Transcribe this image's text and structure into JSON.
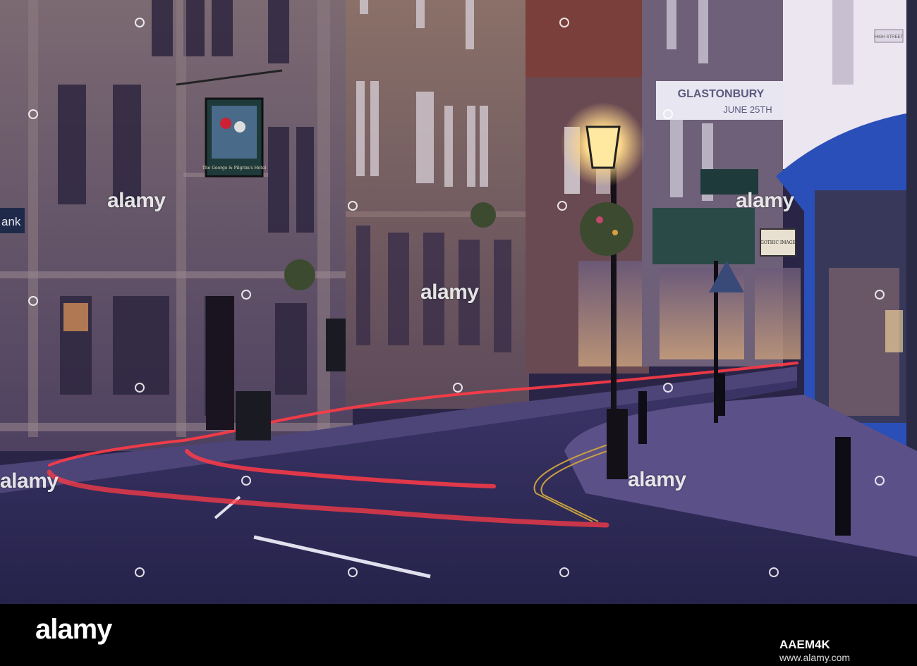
{
  "photo": {
    "description_tag": "street-scene",
    "colors": {
      "sky": "#e8e6f0",
      "stone": "#6e5a66",
      "road": "#2c2a52",
      "pavement": "#5a4f86",
      "light_trail": "#ff3b46",
      "lamp_glow": "#ffd98a",
      "shopfront_blue": "#2a4fb8"
    }
  },
  "signs": {
    "bank_fragment": "ank",
    "banner_line1": "GLASTONBURY",
    "banner_line2": "JUNE 25TH",
    "street_sign": "HIGH STREET",
    "shop_sign_gothic": "GOTHIC IMAGE",
    "hotel_sign": "The George & Pilgrim's Hotel"
  },
  "watermarks": {
    "text": "alamy"
  },
  "footer": {
    "logo": "alamy",
    "image_id": "AAEM4K",
    "url": "www.alamy.com"
  }
}
